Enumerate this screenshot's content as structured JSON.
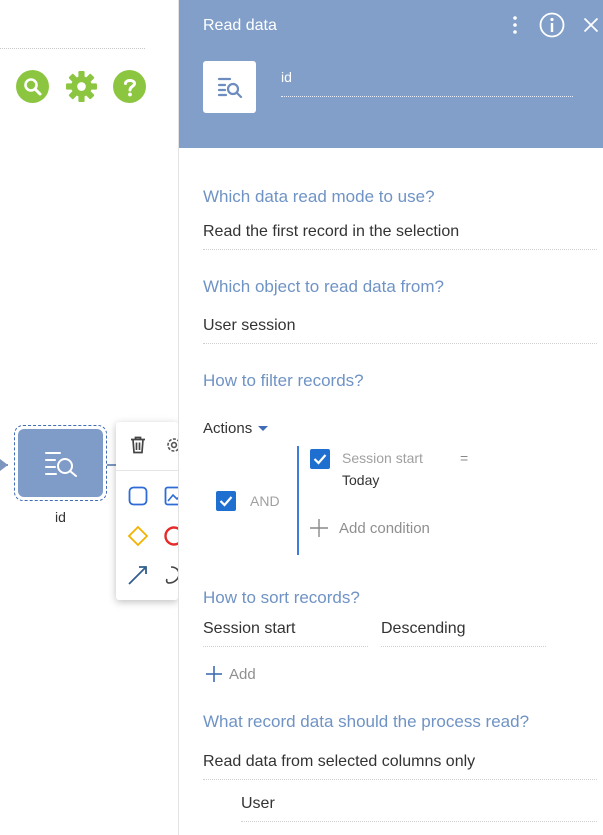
{
  "canvas": {
    "icons": [
      "search-icon",
      "gear-icon",
      "help-icon"
    ],
    "node": {
      "label": "id",
      "icon": "read-data-icon"
    },
    "mini_toolbar": {
      "icons": [
        "delete-icon",
        "settings-icon",
        "task-icon",
        "image-icon",
        "gateway-icon",
        "end-event-icon",
        "connector-icon",
        "subprocess-icon"
      ]
    },
    "colors": {
      "accent_green": "#8cc641",
      "node_blue": "#7f9bc8",
      "selection_blue": "#3f6cb3"
    }
  },
  "panel": {
    "title": "Read data",
    "header_icons": [
      "more-icon",
      "info-icon",
      "close-icon"
    ],
    "element_name": "id",
    "colors": {
      "header": "#819fc8",
      "question": "#6f93c4",
      "checkbox": "#1f6fd1"
    },
    "read_mode": {
      "question": "Which data read mode to use?",
      "value": "Read the first record in the selection"
    },
    "object": {
      "question": "Which object to read data from?",
      "value": "User session"
    },
    "filter": {
      "question": "How to filter records?",
      "actions_label": "Actions",
      "group": {
        "operator": "AND",
        "checked": true
      },
      "conditions": [
        {
          "column": "Session start",
          "operator": "=",
          "value": "Today",
          "checked": true
        }
      ],
      "add_condition_label": "Add condition"
    },
    "sort": {
      "question": "How to sort records?",
      "column": "Session start",
      "direction": "Descending",
      "add_label": "Add"
    },
    "record_data": {
      "question": "What record data should the process read?",
      "value": "Read data from selected columns only",
      "columns": [
        "User"
      ]
    }
  }
}
